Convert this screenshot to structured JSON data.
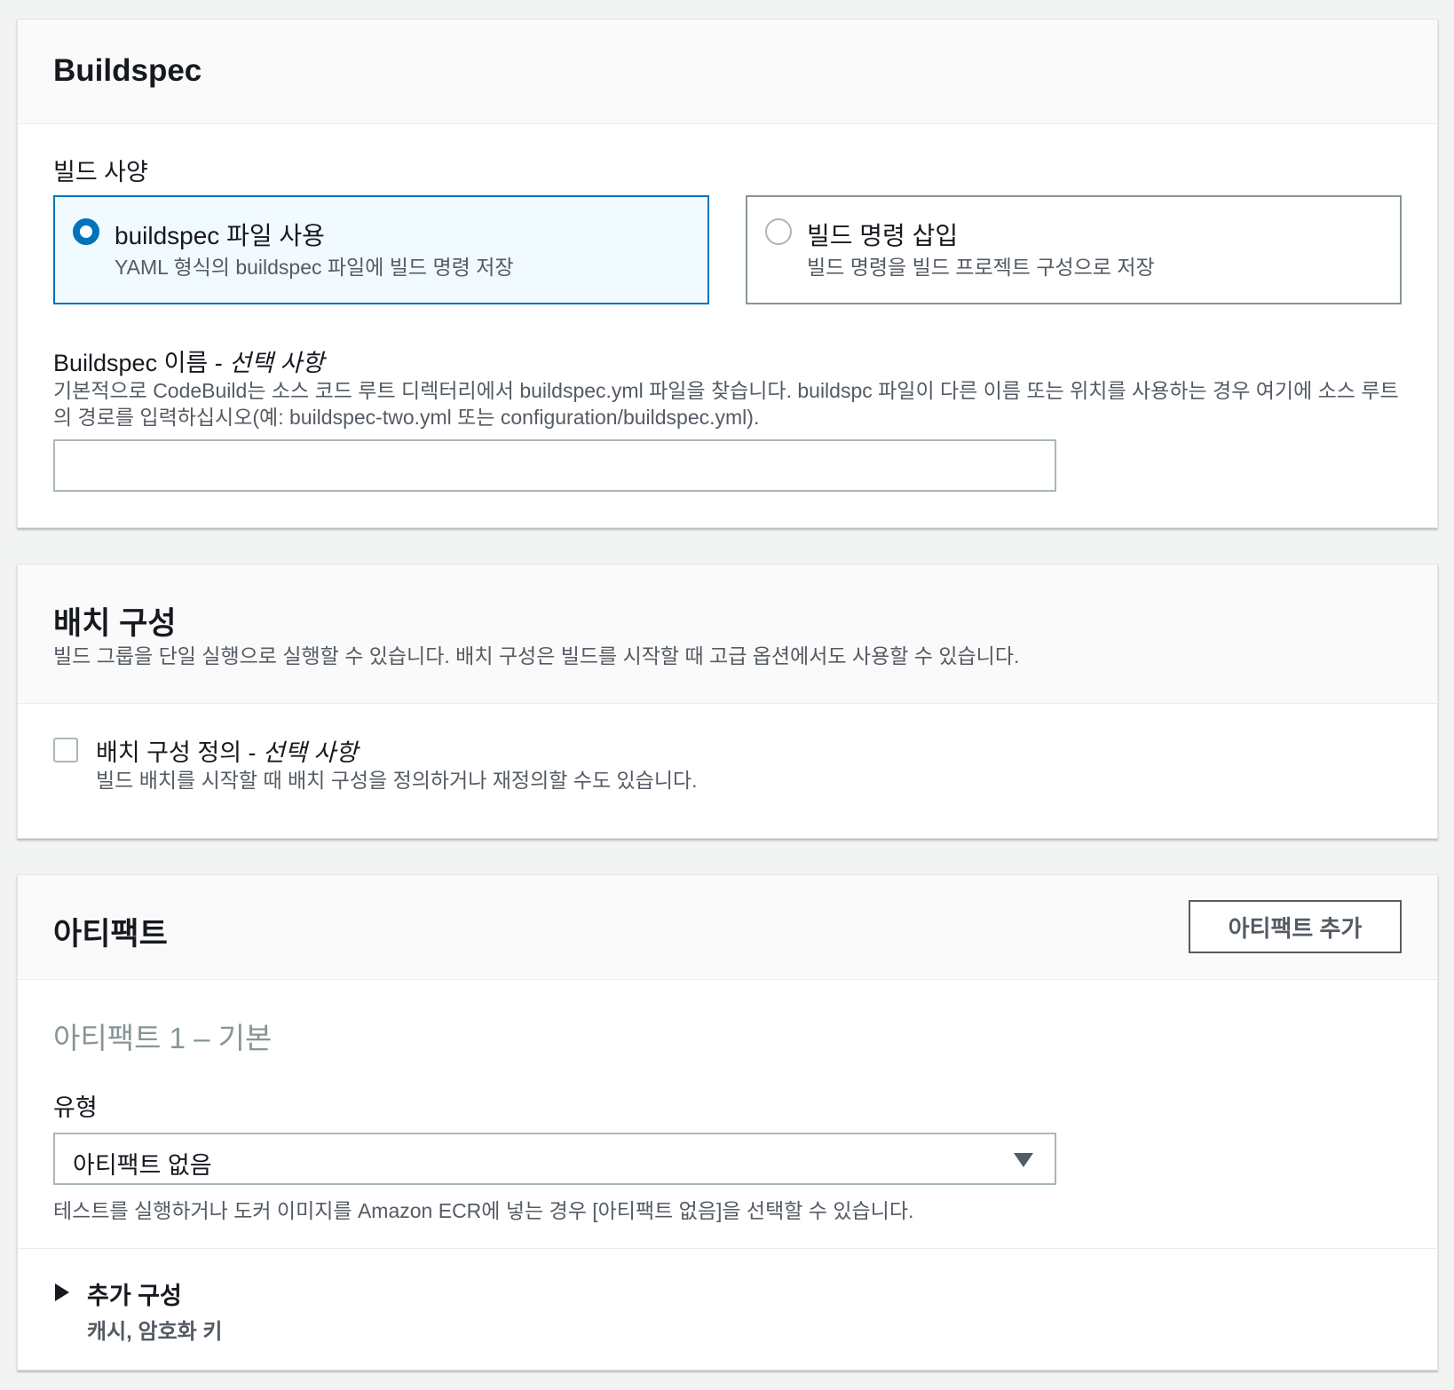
{
  "buildspec": {
    "title": "Buildspec",
    "spec_label": "빌드 사양",
    "option_file_label": "buildspec 파일 사용",
    "option_file_desc": "YAML 형식의 buildspec 파일에 빌드 명령 저장",
    "option_insert_label": "빌드 명령 삽입",
    "option_insert_desc": "빌드 명령을 빌드 프로젝트 구성으로 저장",
    "name_label": "Buildspec 이름 - ",
    "name_optional": "선택 사항",
    "name_desc": "기본적으로 CodeBuild는 소스 코드 루트 디렉터리에서 buildspec.yml 파일을 찾습니다. buildspc 파일이 다른 이름 또는 위치를 사용하는 경우 여기에 소스 루트의 경로를 입력하십시오(예: buildspec-two.yml 또는 configuration/buildspec.yml).",
    "name_value": ""
  },
  "batch": {
    "title": "배치 구성",
    "desc": "빌드 그룹을 단일 실행으로 실행할 수 있습니다. 배치 구성은 빌드를 시작할 때 고급 옵션에서도 사용할 수 있습니다.",
    "checkbox_label": "배치 구성 정의 - ",
    "checkbox_optional": "선택 사항",
    "checkbox_desc": "빌드 배치를 시작할 때 배치 구성을 정의하거나 재정의할 수도 있습니다."
  },
  "artifacts": {
    "title": "아티팩트",
    "add_button": "아티팩트 추가",
    "artifact_heading": "아티팩트 1 – 기본",
    "type_label": "유형",
    "type_value": "아티팩트 없음",
    "type_desc": "테스트를 실행하거나 도커 이미지를 Amazon ECR에 넣는 경우 [아티팩트 없음]을 선택할 수 있습니다.",
    "extra_label": "추가 구성",
    "extra_desc": "캐시, 암호화 키"
  }
}
